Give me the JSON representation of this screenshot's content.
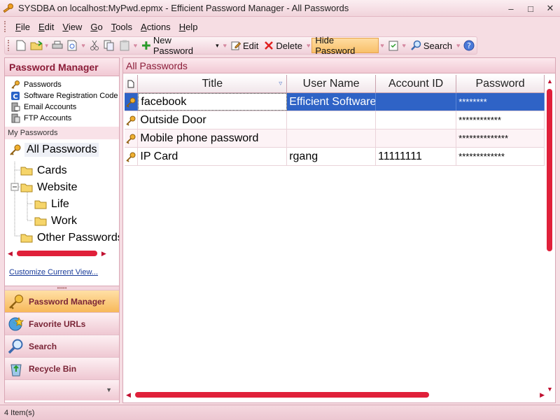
{
  "window": {
    "title": "SYSDBA on localhost:MyPwd.epmx - Efficient Password Manager - All Passwords",
    "minimize": "–",
    "maximize": "□",
    "close": "✕"
  },
  "menu": [
    "File",
    "Edit",
    "View",
    "Go",
    "Tools",
    "Actions",
    "Help"
  ],
  "toolbar": {
    "new_password": "New Password",
    "edit": "Edit",
    "delete": "Delete",
    "hide_password": "Hide Password",
    "search": "Search"
  },
  "left_panel": {
    "header": "Password Manager",
    "shortcuts": [
      "Passwords",
      "Software Registration Code",
      "Email Accounts",
      "FTP Accounts"
    ],
    "my_passwords_label": "My Passwords",
    "all_passwords": "All Passwords",
    "tree": {
      "cards": "Cards",
      "website": "Website",
      "life": "Life",
      "work": "Work",
      "other": "Other Passwords"
    },
    "customize": "Customize Current View...",
    "nav": [
      "Password Manager",
      "Favorite URLs",
      "Search",
      "Recycle Bin"
    ]
  },
  "right_panel": {
    "header": "All Passwords",
    "columns": [
      "Title",
      "User Name",
      "Account ID",
      "Password"
    ],
    "rows": [
      {
        "title": "facebook",
        "user": "Efficient Software",
        "account": "",
        "password": "********"
      },
      {
        "title": "Outside Door",
        "user": "",
        "account": "",
        "password": "************"
      },
      {
        "title": "Mobile phone password",
        "user": "",
        "account": "",
        "password": "**************"
      },
      {
        "title": "IP Card",
        "user": "rgang",
        "account": "11111111",
        "password": "*************"
      }
    ]
  },
  "status": "4 Item(s)",
  "colors": {
    "accent": "#8b1c38",
    "selection": "#2f63c6",
    "active_button": "#f8c06a",
    "scroll": "#e0203a"
  }
}
